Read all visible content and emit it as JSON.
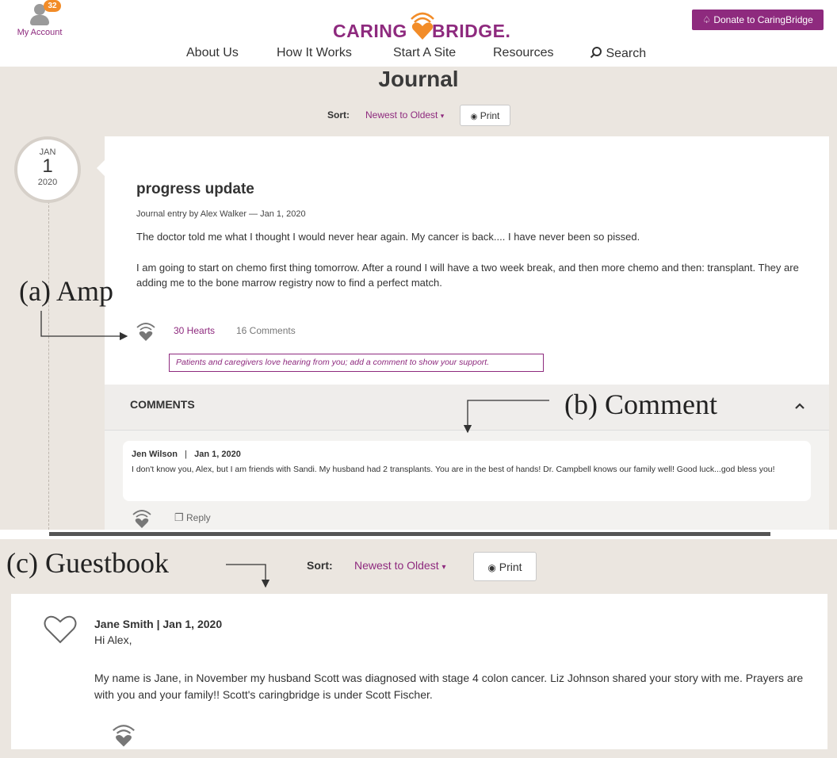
{
  "header": {
    "account_label": "My Account",
    "notification_count": "32",
    "logo_left": "CARING",
    "logo_right": "BRIDGE.",
    "donate_label": "Donate to CaringBridge",
    "nav": [
      "About Us",
      "How It Works",
      "Start A Site",
      "Resources",
      "Search"
    ]
  },
  "journal": {
    "title": "Journal",
    "sort_label": "Sort:",
    "sort_value": "Newest to Oldest",
    "print_label": "Print",
    "date": {
      "month": "JAN",
      "day": "1",
      "year": "2020"
    },
    "entry": {
      "title": "progress update",
      "byline": "Journal entry by Alex Walker — Jan 1, 2020",
      "paragraphs": [
        "The doctor told me what I thought I would never hear again. My cancer is back.... I have never been so pissed.",
        "I am going to start on chemo first thing tomorrow. After a round I will have a two week break, and then more chemo and then: transplant. They are adding me to the bone marrow registry now to find a perfect match."
      ],
      "hearts": "30 Hearts",
      "comments_count": "16 Comments",
      "prompt": "Patients and caregivers love hearing from you; add a comment to show your support."
    },
    "comments": {
      "title": "COMMENTS",
      "items": [
        {
          "author": "Jen Wilson",
          "separator": "|",
          "date": "Jan 1, 2020",
          "text": "I don't know you, Alex, but I am friends with Sandi. My husband had 2 transplants. You are in the best of hands! Dr. Campbell knows our family well! Good luck...god bless you!",
          "reply_label": "Reply"
        }
      ]
    }
  },
  "guestbook": {
    "sort_label": "Sort:",
    "sort_value": "Newest to Oldest",
    "print_label": "Print",
    "entry": {
      "byline": "Jane Smith | Jan 1, 2020",
      "greeting": "Hi Alex,",
      "body": "My name is Jane, in November my husband Scott was diagnosed with stage 4 colon cancer. Liz Johnson shared your story with me. Prayers are with you and your family!! Scott's caringbridge is under Scott Fischer."
    }
  },
  "annotations": {
    "a": "(a) Amp",
    "b": "(b) Comment",
    "c": "(c) Guestbook"
  },
  "colors": {
    "brand_purple": "#8e2a7e",
    "brand_orange": "#f28c28",
    "page_beige": "#ebe6e0"
  }
}
